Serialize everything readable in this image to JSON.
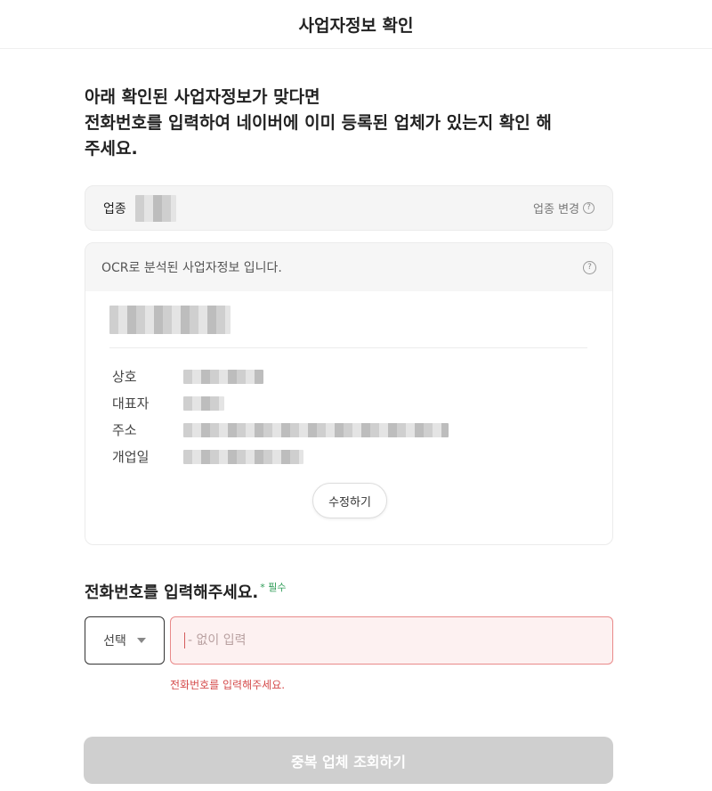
{
  "header": {
    "title": "사업자정보 확인"
  },
  "intro": {
    "line1": "아래 확인된 사업자정보가 맞다면",
    "line2": "전화번호를 입력하여 네이버에 이미 등록된 업체가 있는지 확인 해",
    "line3": "주세요."
  },
  "industry": {
    "label": "업종",
    "change_label": "업종 변경"
  },
  "ocr": {
    "header_text": "OCR로 분석된 사업자정보 입니다.",
    "fields": [
      {
        "label": "상호"
      },
      {
        "label": "대표자"
      },
      {
        "label": "주소"
      },
      {
        "label": "개업일"
      }
    ],
    "edit_label": "수정하기"
  },
  "phone": {
    "title": "전화번호를 입력해주세요.",
    "required_mark": "* 필수",
    "select_label": "선택",
    "input_placeholder": "- 없이 입력",
    "input_value": "",
    "error_text": "전화번호를 입력해주세요."
  },
  "submit": {
    "label": "중복 업체 조회하기"
  }
}
